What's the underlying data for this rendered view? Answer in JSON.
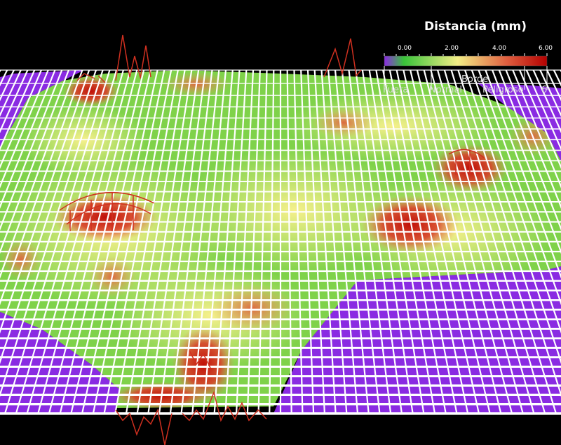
{
  "legend": {
    "title": "Distancia (mm)",
    "ticks": [
      "0.00",
      "2.00",
      "4.00",
      "6.00"
    ],
    "categories": [
      "Fuera",
      "Normal",
      "Borde",
      "Peligroso",
      "6"
    ],
    "gradient": [
      "#8a2be2",
      "#39c339",
      "#f2ee86",
      "#e06040",
      "#b40000"
    ]
  },
  "colors": {
    "background": "#000000",
    "outside": "#8a2be2",
    "grid": "#ffffff",
    "green": "#5fd33c",
    "yellow": "#f3ee86",
    "orange": "#e08a50",
    "red": "#c41a0e"
  }
}
